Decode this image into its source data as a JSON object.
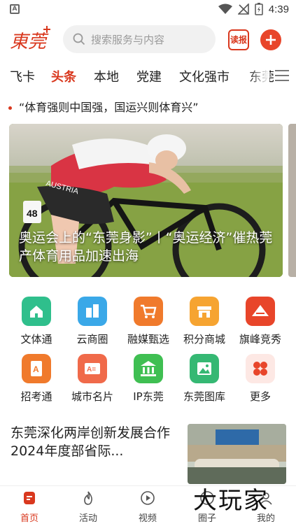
{
  "status_bar": {
    "time": "4:39"
  },
  "header": {
    "logo_text": "東莞",
    "search_placeholder": "搜索服务与内容",
    "dubao_label": "读报"
  },
  "tabs": [
    "飞卡",
    "头条",
    "本地",
    "党建",
    "文化强市",
    "东莞"
  ],
  "headline": "“体育强则中国强，国运兴则体育兴”",
  "banner": {
    "caption": "奥运会上的“东莞身影”丨“奥运经济”催热莞产体育用品加速出海",
    "jersey_text": "AUSTRIA",
    "bib_number": "48"
  },
  "services": [
    {
      "label": "文体通",
      "icon": "home-icon",
      "color": "#2fbf8c"
    },
    {
      "label": "云商圈",
      "icon": "buildings-icon",
      "color": "#3aa8e8"
    },
    {
      "label": "融媒甄选",
      "icon": "cart-icon",
      "color": "#f07a2c"
    },
    {
      "label": "积分商城",
      "icon": "store-icon",
      "color": "#f6a431"
    },
    {
      "label": "旗峰竞秀",
      "icon": "mountain-icon",
      "color": "#e8452a"
    },
    {
      "label": "招考通",
      "icon": "exam-icon",
      "color": "#f07a2c"
    },
    {
      "label": "城市名片",
      "icon": "card-icon",
      "color": "#f06a4a"
    },
    {
      "label": "IP东莞",
      "icon": "museum-icon",
      "color": "#3fbf52"
    },
    {
      "label": "东莞图库",
      "icon": "image-icon",
      "color": "#35b873"
    },
    {
      "label": "更多",
      "icon": "more-icon",
      "color": "#e8452a"
    }
  ],
  "news": {
    "title": "东莞深化两岸创新发展合作2024年度部省际..."
  },
  "bottom_nav": [
    {
      "label": "首页",
      "icon": "home-doc-icon"
    },
    {
      "label": "活动",
      "icon": "flame-icon"
    },
    {
      "label": "视频",
      "icon": "play-icon"
    },
    {
      "label": "圈子",
      "icon": "circle-icon"
    },
    {
      "label": "我的",
      "icon": "profile-icon"
    }
  ],
  "watermark": "大玩家",
  "colors": {
    "accent": "#d9381e",
    "accent_light": "#e8452a"
  }
}
